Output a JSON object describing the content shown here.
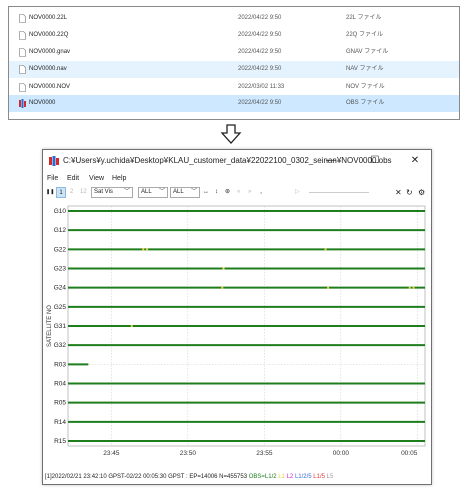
{
  "explorer": {
    "files": [
      {
        "name": "NOV0000.22L",
        "date": "2022/04/22 9:50",
        "type": "22L ファイル",
        "state": "normal",
        "icon": "document-icon"
      },
      {
        "name": "NOV0000.22Q",
        "date": "2022/04/22 9:50",
        "type": "22Q ファイル",
        "state": "normal",
        "icon": "document-icon"
      },
      {
        "name": "NOV0000.gnav",
        "date": "2022/04/22 9:50",
        "type": "GNAV ファイル",
        "state": "normal",
        "icon": "document-icon"
      },
      {
        "name": "NOV0000.nav",
        "date": "2022/04/22 9:50",
        "type": "NAV ファイル",
        "state": "hover",
        "icon": "document-icon"
      },
      {
        "name": "NOV0000.NOV",
        "date": "2022/03/02 11:33",
        "type": "NOV ファイル",
        "state": "normal",
        "icon": "document-icon"
      },
      {
        "name": "NOV0000",
        "date": "2022/04/22 9:50",
        "type": "OBS ファイル",
        "state": "selected",
        "icon": "obs-file-icon"
      }
    ]
  },
  "window": {
    "title": "C:¥Users¥y.uchida¥Desktop¥KLAU_customer_data¥22022100_0302_seinan¥NOV0000.obs",
    "minimize": "—",
    "maximize": "☐",
    "close": "✕"
  },
  "menu": {
    "file": "File",
    "edit": "Edit",
    "view": "View",
    "help": "Help"
  },
  "toolbar": {
    "pause": "❚❚",
    "freq1": "1",
    "freq2": "2",
    "freq12": "12",
    "plot_type": "Sat Vis",
    "sys_filter": "ALL",
    "sat_filter": "ALL",
    "fit_icon": "↔",
    "vfit_icon": "↕",
    "target_icon": "⊛",
    "prev_icon": "«",
    "next_icon": "»",
    "dot_icon": "●",
    "play_icon": "▷",
    "close_icon": "✕",
    "reload_icon": "↻",
    "settings_icon": "⚙"
  },
  "chart_data": {
    "type": "timeline",
    "ylabel": "SATELLITE NO",
    "satellites": [
      "G10",
      "G12",
      "G22",
      "G23",
      "G24",
      "G25",
      "G31",
      "G32",
      "R03",
      "R04",
      "R05",
      "R14",
      "R15"
    ],
    "x_ticks": [
      "23:45",
      "23:50",
      "23:55",
      "00:00",
      "00:05"
    ],
    "x_range": [
      "23:42:10",
      "00:05:30"
    ],
    "color_normal": "#1e7e1e",
    "color_slip": "#e8d23a",
    "tracks": [
      {
        "sat": "G10",
        "start": "23:42:10",
        "end": "00:05:30",
        "marks": []
      },
      {
        "sat": "G12",
        "start": "23:42:10",
        "end": "00:05:30",
        "marks": []
      },
      {
        "sat": "G22",
        "start": "23:42:10",
        "end": "00:05:30",
        "marks": [
          "23:47:05",
          "23:47:20",
          "23:59:00"
        ]
      },
      {
        "sat": "G23",
        "start": "23:42:10",
        "end": "00:05:30",
        "marks": [
          "23:52:20"
        ]
      },
      {
        "sat": "G24",
        "start": "23:42:10",
        "end": "00:05:30",
        "marks": [
          "23:52:15",
          "23:59:10",
          "00:04:30",
          "00:04:45"
        ]
      },
      {
        "sat": "G25",
        "start": "23:42:10",
        "end": "00:05:30",
        "marks": []
      },
      {
        "sat": "G31",
        "start": "23:42:10",
        "end": "00:05:30",
        "marks": [
          "23:46:20"
        ]
      },
      {
        "sat": "G32",
        "start": "23:42:10",
        "end": "00:05:30",
        "marks": []
      },
      {
        "sat": "R03",
        "start": "23:42:10",
        "end": "23:43:30",
        "marks": []
      },
      {
        "sat": "R04",
        "start": "23:42:10",
        "end": "00:05:30",
        "marks": []
      },
      {
        "sat": "R05",
        "start": "23:42:10",
        "end": "00:05:30",
        "marks": []
      },
      {
        "sat": "R14",
        "start": "23:42:10",
        "end": "00:05:30",
        "marks": []
      },
      {
        "sat": "R15",
        "start": "23:42:10",
        "end": "00:05:30",
        "marks": []
      }
    ]
  },
  "status": {
    "info": "[1]2022/02/21 23:42:10 GPST-02/22 00:05:30 GPST : EP=14006 N=455753 ",
    "legend": [
      {
        "label": "OBS=L1/2 ",
        "color": "#1e7e1e"
      },
      {
        "label": "L1 ",
        "color": "#e8d23a"
      },
      {
        "label": "L2 ",
        "color": "#e01fe0"
      },
      {
        "label": "L1/2/5 ",
        "color": "#3a6bd6"
      },
      {
        "label": "L1/5 ",
        "color": "#e03a3a"
      },
      {
        "label": "L5",
        "color": "#9a9a9a"
      }
    ]
  }
}
